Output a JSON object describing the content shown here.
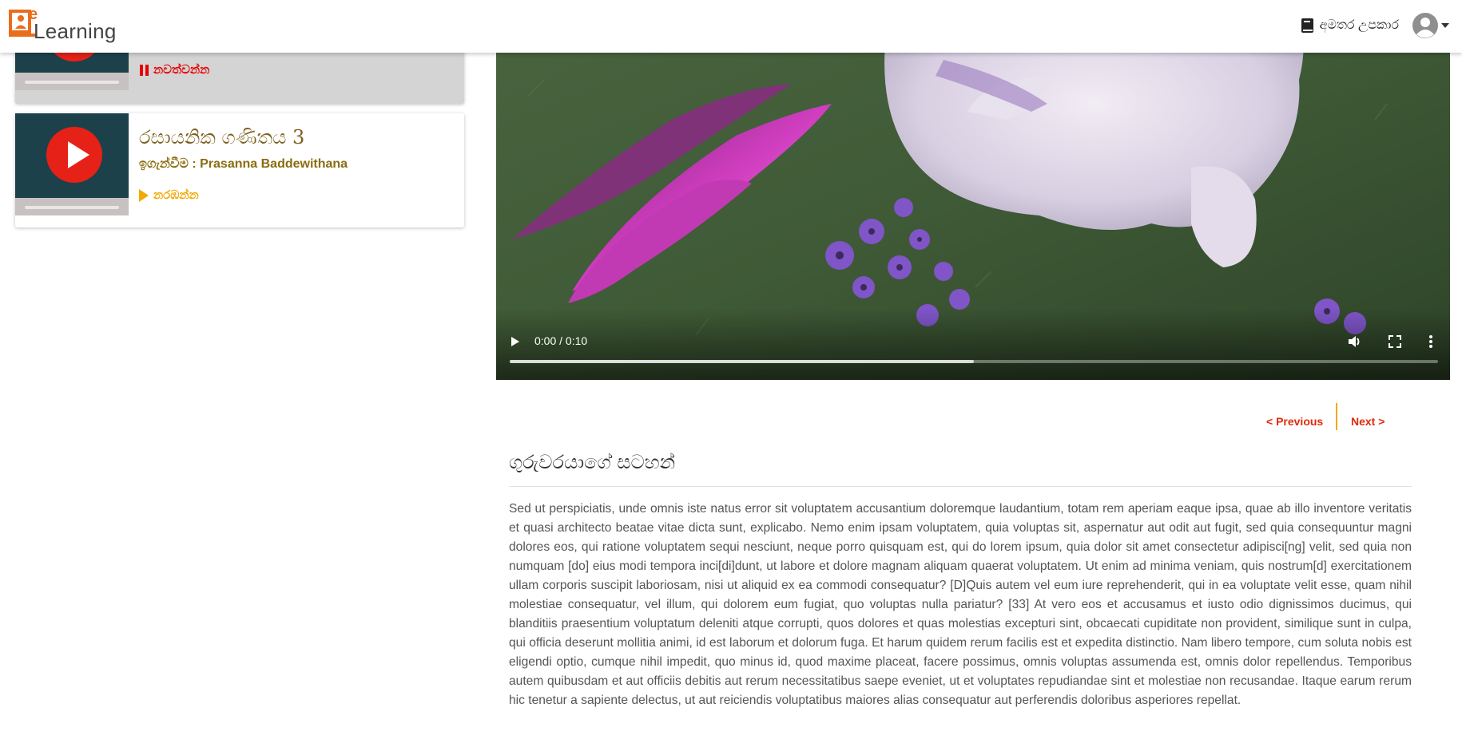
{
  "header": {
    "logo_letter": "e",
    "logo_word": "Learning",
    "user_name": "අමතර උපකාර"
  },
  "lessons": [
    {
      "title": "",
      "action_label": "නවත්වන්න",
      "state": "playing"
    },
    {
      "title": "රසායනික ගණිතය 3",
      "teacher": "ඉගැන්වීම : Prasanna Baddewithana",
      "action_label": "නරඹන්න",
      "state": "not-started"
    }
  ],
  "video": {
    "time_display": "0:00 / 0:10",
    "buffered_fraction": 0.5
  },
  "navigation": {
    "previous_label": "< Previous",
    "next_label": "Next >"
  },
  "notes": {
    "heading": "ගුරුවරයාගේ සටහන්",
    "body": "Sed ut perspiciatis, unde omnis iste natus error sit voluptatem accusantium doloremque laudantium, totam rem aperiam eaque ipsa, quae ab illo inventore veritatis et quasi architecto beatae vitae dicta sunt, explicabo. Nemo enim ipsam voluptatem, quia voluptas sit, aspernatur aut odit aut fugit, sed quia consequuntur magni dolores eos, qui ratione voluptatem sequi nesciunt, neque porro quisquam est, qui do lorem ipsum, quia dolor sit amet consectetur adipisci[ng] velit, sed quia non numquam [do] eius modi tempora inci[di]dunt, ut labore et dolore magnam aliquam quaerat voluptatem. Ut enim ad minima veniam, quis nostrum[d] exercitationem ullam corporis suscipit laboriosam, nisi ut aliquid ex ea commodi consequatur? [D]Quis autem vel eum iure reprehenderit, qui in ea voluptate velit esse, quam nihil molestiae consequatur, vel illum, qui dolorem eum fugiat, quo voluptas nulla pariatur? [33] At vero eos et accusamus et iusto odio dignissimos ducimus, qui blanditiis praesentium voluptatum deleniti atque corrupti, quos dolores et quas molestias excepturi sint, obcaecati cupiditate non provident, similique sunt in culpa, qui officia deserunt mollitia animi, id est laborum et dolorum fuga. Et harum quidem rerum facilis est et expedita distinctio. Nam libero tempore, cum soluta nobis est eligendi optio, cumque nihil impedit, quo minus id, quod maxime placeat, facere possimus, omnis voluptas assumenda est, omnis dolor repellendus. Temporibus autem quibusdam et aut officiis debitis aut rerum necessitatibus saepe eveniet, ut et voluptates repudiandae sint et molestiae non recusandae. Itaque earum rerum hic tenetur a sapiente delectus, ut aut reiciendis voluptatibus maiores alias consequatur aut perferendis doloribus asperiores repellat."
  }
}
